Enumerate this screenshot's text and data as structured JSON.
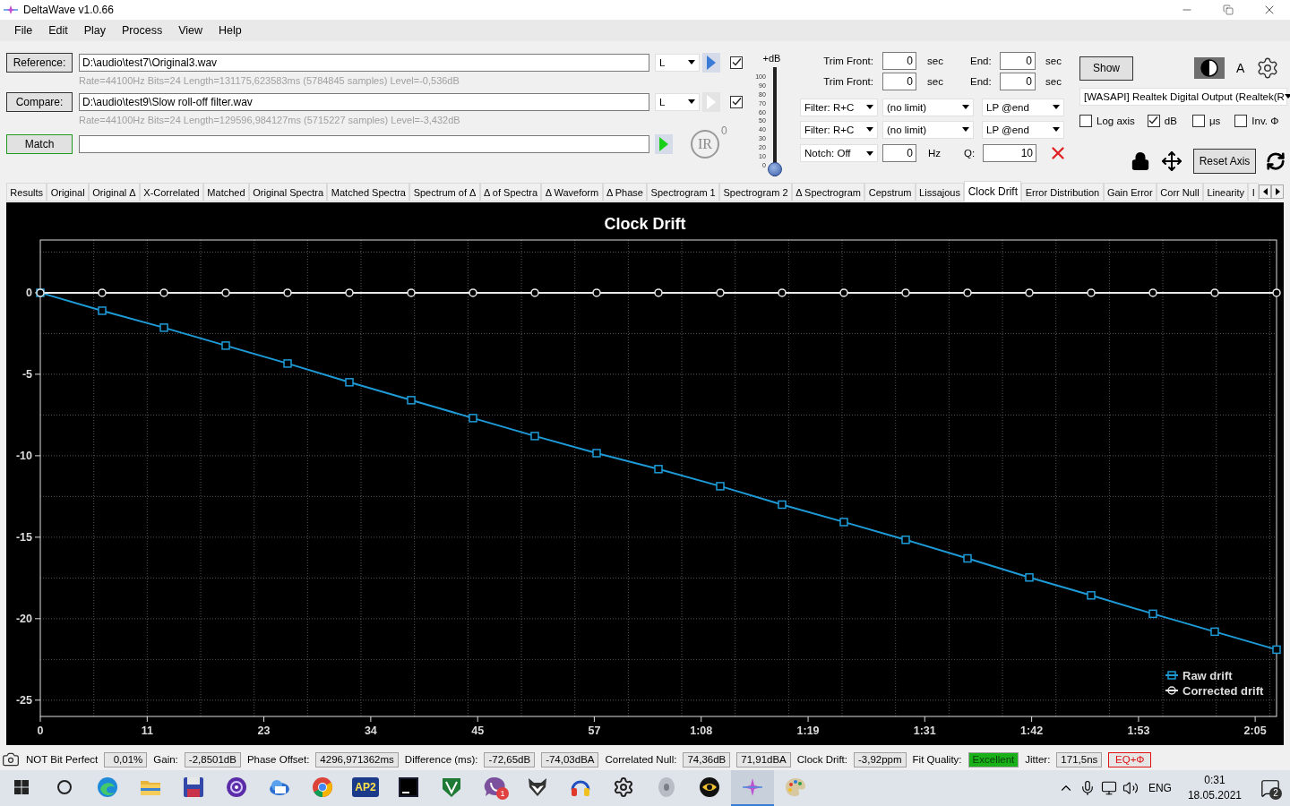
{
  "window": {
    "title": "DeltaWave v1.0.66"
  },
  "menu": [
    "File",
    "Edit",
    "Play",
    "Process",
    "View",
    "Help"
  ],
  "files": [
    {
      "button": "Reference:",
      "path": "D:\\audio\\test7\\Original3.wav",
      "info": "Rate=44100Hz Bits=24 Length=131175,623583ms (5784845 samples) Level=-0,536dB",
      "channel": "L",
      "play_enabled": true,
      "checked": true
    },
    {
      "button": "Compare:",
      "path": "D:\\audio\\test9\\Slow roll-off filter.wav",
      "info": "Rate=44100Hz Bits=24 Length=129596,984127ms (5715227 samples) Level=-3,432dB",
      "channel": "L",
      "play_enabled": false,
      "checked": true
    }
  ],
  "match": {
    "button": "Match",
    "ir_label": "IR",
    "ir_count": "0"
  },
  "gain_slider": {
    "label": "+dB",
    "scale": [
      "100",
      "90",
      "80",
      "70",
      "60",
      "50",
      "40",
      "30",
      "20",
      "10",
      "0"
    ],
    "level": 0
  },
  "trim": [
    {
      "front_label": "Trim Front:",
      "front": "0",
      "front_unit": "sec",
      "end_label": "End:",
      "end": "0",
      "end_unit": "sec"
    },
    {
      "front_label": "Trim Front:",
      "front": "0",
      "front_unit": "sec",
      "end_label": "End:",
      "end": "0",
      "end_unit": "sec"
    }
  ],
  "filters": [
    {
      "type": "Filter: R+C",
      "limit": "(no limit)",
      "lp": "LP @end"
    },
    {
      "type": "Filter: R+C",
      "limit": "(no limit)",
      "lp": "LP @end"
    }
  ],
  "notch": {
    "type": "Notch: Off",
    "freq": "0",
    "freq_unit": "Hz",
    "q_label": "Q:",
    "q": "10"
  },
  "show_button": "Show",
  "font_label": "A",
  "output_device": "[WASAPI] Realtek Digital Output (Realtek(R",
  "options": [
    {
      "label": "Log axis",
      "checked": false
    },
    {
      "label": "dB",
      "checked": true
    },
    {
      "label": "μs",
      "checked": false
    },
    {
      "label": "Inv. Φ",
      "checked": false
    }
  ],
  "reset_axis": "Reset Axis",
  "tabs": [
    {
      "label": "Results",
      "selected": false
    },
    {
      "label": "Original",
      "selected": false
    },
    {
      "label": "Original Δ",
      "selected": false
    },
    {
      "label": "X-Correlated",
      "selected": false
    },
    {
      "label": "Matched",
      "selected": false
    },
    {
      "label": "Original Spectra",
      "selected": false
    },
    {
      "label": "Matched Spectra",
      "selected": false
    },
    {
      "label": "Spectrum of Δ",
      "selected": false
    },
    {
      "label": "Δ of Spectra",
      "selected": false
    },
    {
      "label": "Δ Waveform",
      "selected": false
    },
    {
      "label": "Δ Phase",
      "selected": false
    },
    {
      "label": "Spectrogram 1",
      "selected": false
    },
    {
      "label": "Spectrogram 2",
      "selected": false
    },
    {
      "label": "Δ Spectrogram",
      "selected": false
    },
    {
      "label": "Cepstrum",
      "selected": false
    },
    {
      "label": "Lissajous",
      "selected": false
    },
    {
      "label": "Clock Drift",
      "selected": true
    },
    {
      "label": "Error Distribution",
      "selected": false
    },
    {
      "label": "Gain Error",
      "selected": false
    },
    {
      "label": "Corr Null",
      "selected": false
    },
    {
      "label": "Linearity",
      "selected": false
    },
    {
      "label": "I",
      "selected": false
    }
  ],
  "chart": {
    "chart_data": {
      "type": "line",
      "title": "Clock Drift",
      "x": [
        0,
        6.36,
        12.72,
        19.08,
        25.44,
        31.8,
        38.16,
        44.52,
        50.88,
        57.24,
        63.6,
        69.96,
        76.32,
        82.68,
        89.04,
        95.4,
        101.76,
        108.12,
        114.48,
        120.84,
        127.2
      ],
      "series": [
        {
          "name": "Raw drift",
          "color": "#1e9bd7",
          "marker": "square",
          "values": [
            0,
            -1.1,
            -2.14,
            -3.24,
            -4.34,
            -5.49,
            -6.59,
            -7.69,
            -8.79,
            -9.84,
            -10.82,
            -11.87,
            -13.0,
            -14.07,
            -15.16,
            -16.3,
            -17.47,
            -18.57,
            -19.7,
            -20.8,
            -21.9
          ]
        },
        {
          "name": "Corrected drift",
          "color": "#e8e8e8",
          "marker": "circle",
          "values": [
            0,
            0,
            0,
            0,
            0,
            0,
            0,
            0,
            0,
            0,
            0,
            0,
            0,
            0,
            0,
            0,
            0,
            0,
            0,
            0,
            0
          ]
        }
      ],
      "xlim": [
        0,
        127.2
      ],
      "ylim": [
        -26,
        3.24
      ],
      "xticks": [
        {
          "value": 0,
          "label": "0"
        },
        {
          "value": 11,
          "label": "11"
        },
        {
          "value": 23,
          "label": "23"
        },
        {
          "value": 34,
          "label": "34"
        },
        {
          "value": 45,
          "label": "45"
        },
        {
          "value": 57,
          "label": "57"
        },
        {
          "value": 68,
          "label": "1:08"
        },
        {
          "value": 79,
          "label": "1:19"
        },
        {
          "value": 91,
          "label": "1:31"
        },
        {
          "value": 102,
          "label": "1:42"
        },
        {
          "value": 113,
          "label": "1:53"
        },
        {
          "value": 125,
          "label": "2:05"
        }
      ],
      "grid": true,
      "legend": "lower right",
      "yticks": [
        0,
        -5,
        -10,
        -15,
        -20,
        -25
      ]
    }
  },
  "status_bar": [
    {
      "kind": "label",
      "text": "NOT Bit Perfect"
    },
    {
      "kind": "value",
      "text": "0,01%"
    },
    {
      "kind": "label",
      "text": "Gain:"
    },
    {
      "kind": "value",
      "text": "-2,8501dB"
    },
    {
      "kind": "label",
      "text": "Phase Offset:"
    },
    {
      "kind": "value",
      "text": "4296,971362ms"
    },
    {
      "kind": "label",
      "text": "Difference (ms):"
    },
    {
      "kind": "value",
      "text": "-72,65dB"
    },
    {
      "kind": "value",
      "text": "-74,03dBA"
    },
    {
      "kind": "label",
      "text": "Correlated Null:"
    },
    {
      "kind": "value",
      "text": "74,36dB"
    },
    {
      "kind": "value",
      "text": "71,91dBA"
    },
    {
      "kind": "label",
      "text": "Clock Drift:"
    },
    {
      "kind": "value",
      "text": "-3,92ppm"
    },
    {
      "kind": "label",
      "text": "Fit Quality:"
    },
    {
      "kind": "quality",
      "text": "Excellent"
    },
    {
      "kind": "label",
      "text": "Jitter:"
    },
    {
      "kind": "value",
      "text": "171,5ns"
    },
    {
      "kind": "flag",
      "text": "EQ+Φ"
    }
  ],
  "taskbar": {
    "apps": [
      {
        "kind": "edge",
        "selected": false
      },
      {
        "kind": "folder",
        "selected": false
      },
      {
        "kind": "floppy",
        "selected": false
      },
      {
        "kind": "podcast",
        "selected": false
      },
      {
        "kind": "mail",
        "selected": false
      },
      {
        "kind": "chrome",
        "selected": false
      },
      {
        "kind": "ap2",
        "label": "AP2",
        "selected": false
      },
      {
        "kind": "jetbrains",
        "selected": false
      },
      {
        "kind": "shield",
        "selected": false
      },
      {
        "kind": "viber",
        "badge": "1",
        "selected": false
      },
      {
        "kind": "fox",
        "selected": false
      },
      {
        "kind": "headphones",
        "selected": false
      },
      {
        "kind": "settings",
        "selected": false
      },
      {
        "kind": "disc",
        "selected": false
      },
      {
        "kind": "eye",
        "selected": false
      },
      {
        "kind": "deltawave",
        "selected": true
      },
      {
        "kind": "palette",
        "selected": false
      }
    ],
    "language": "ENG",
    "time": "0:31",
    "date": "18.05.2021",
    "notifications": "2"
  }
}
